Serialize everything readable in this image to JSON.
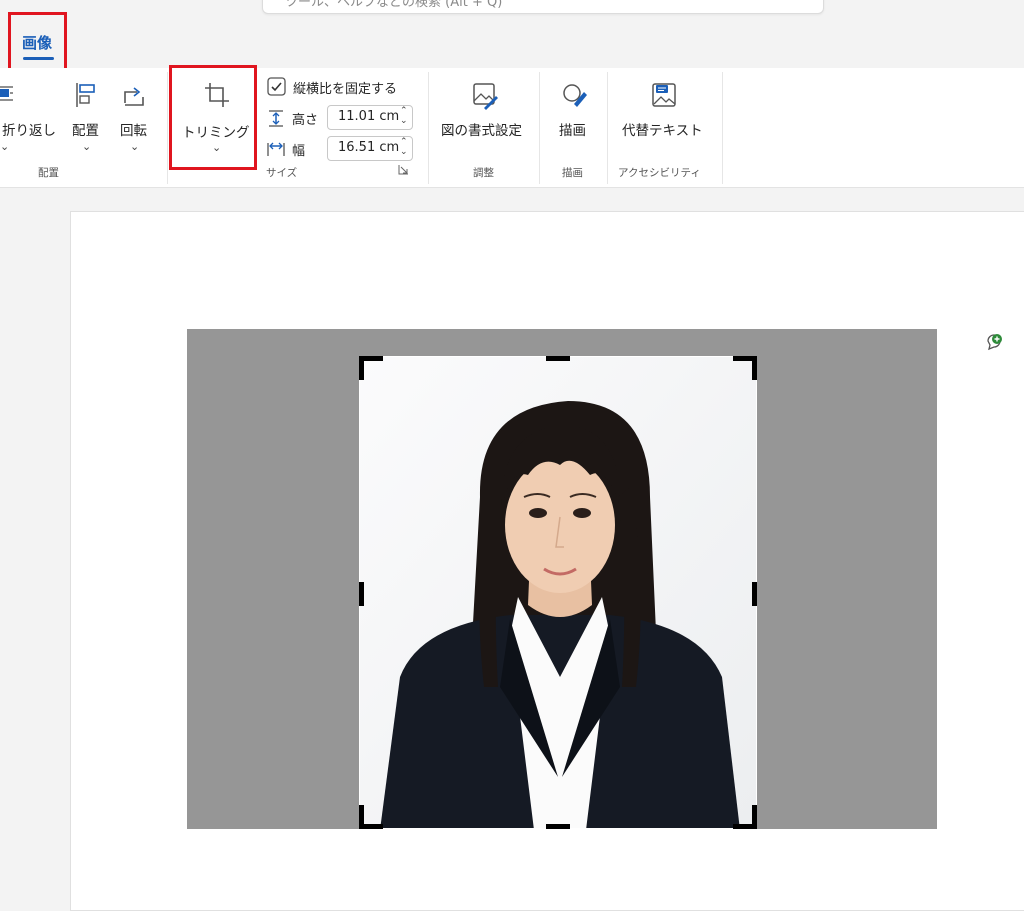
{
  "search": {
    "placeholder": "ツール、ヘルプなどの検索 (Alt + Q)"
  },
  "ribbon_tab": {
    "label": "画像"
  },
  "ribbon": {
    "arrange_group": {
      "wrap_text_label": "折り返し",
      "position_label": "配置",
      "rotate_label": "回転",
      "group_label": "配置"
    },
    "crop_label": "トリミング",
    "size_group": {
      "lock_aspect_label": "縦横比を固定する",
      "lock_aspect_checked": true,
      "height_label": "高さ",
      "height_value": "11.01 cm",
      "width_label": "幅",
      "width_value": "16.51 cm",
      "group_label": "サイズ"
    },
    "adjust_group": {
      "format_picture_label": "図の書式設定",
      "group_label": "調整"
    },
    "draw_group": {
      "draw_label": "描画",
      "group_label": "描画"
    },
    "accessibility_group": {
      "alt_text_label": "代替テキスト",
      "group_label": "アクセシビリティ"
    }
  },
  "colors": {
    "accent": "#1b5fb8",
    "highlight": "#e0151f",
    "crop_background": "#969696"
  },
  "icons": [
    "wrap-text-icon",
    "position-icon",
    "rotate-icon",
    "crop-icon",
    "height-icon",
    "width-icon",
    "format-picture-icon",
    "draw-icon",
    "alt-text-icon",
    "add-comment-icon",
    "chevron-down-icon"
  ]
}
